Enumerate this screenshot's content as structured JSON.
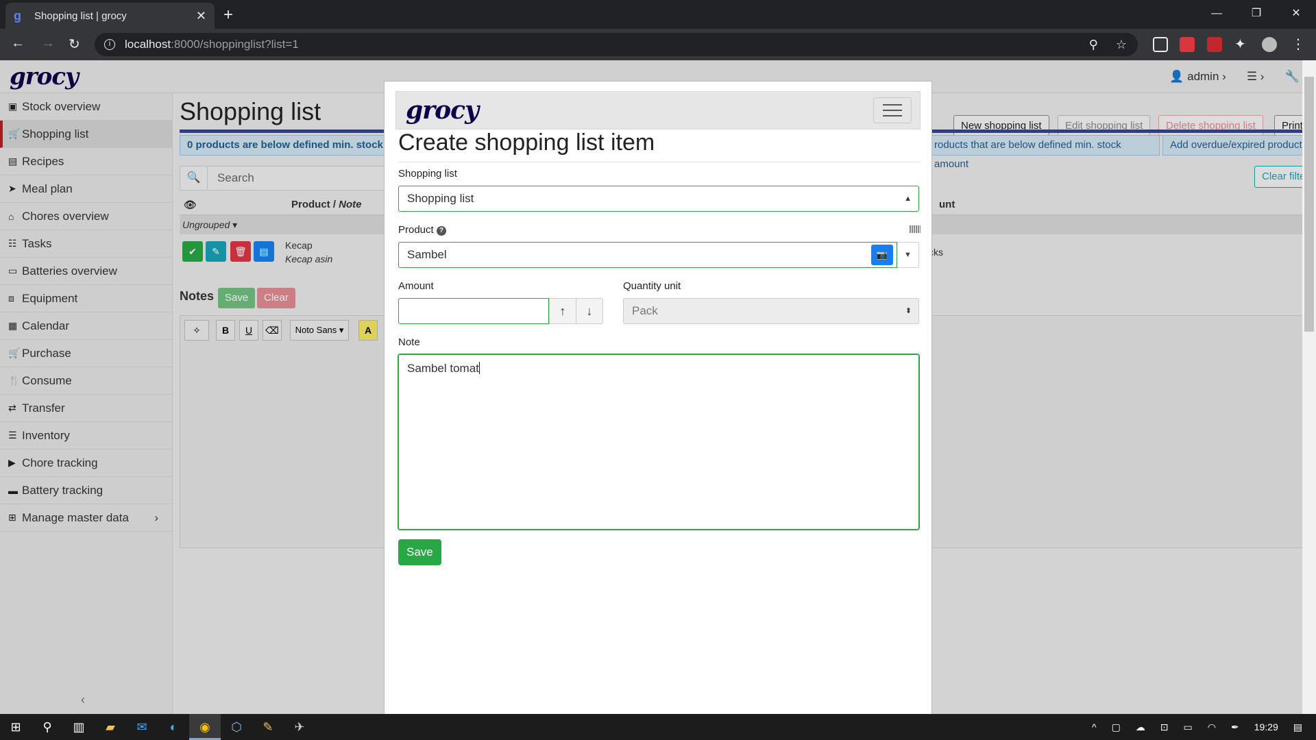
{
  "browser": {
    "tab_title": "Shopping list | grocy",
    "tab_favicon": "g",
    "url_host": "localhost",
    "url_path": ":8000/shoppinglist?list=1"
  },
  "app": {
    "logo": "grocy",
    "user": "admin"
  },
  "sidebar": {
    "items": [
      {
        "label": "Stock overview",
        "icon": "box-icon"
      },
      {
        "label": "Shopping list",
        "icon": "cart-icon"
      },
      {
        "label": "Recipes",
        "icon": "paste-icon"
      },
      {
        "label": "Meal plan",
        "icon": "paper-plane-icon"
      },
      {
        "label": "Chores overview",
        "icon": "home-icon"
      },
      {
        "label": "Tasks",
        "icon": "tasks-icon"
      },
      {
        "label": "Batteries overview",
        "icon": "battery-icon"
      },
      {
        "label": "Equipment",
        "icon": "toolbox-icon"
      },
      {
        "label": "Calendar",
        "icon": "calendar-icon"
      },
      {
        "label": "Purchase",
        "icon": "cart-plus-icon"
      },
      {
        "label": "Consume",
        "icon": "utensils-icon"
      },
      {
        "label": "Transfer",
        "icon": "exchange-icon"
      },
      {
        "label": "Inventory",
        "icon": "list-icon"
      },
      {
        "label": "Chore tracking",
        "icon": "play-icon"
      },
      {
        "label": "Battery tracking",
        "icon": "car-battery-icon"
      },
      {
        "label": "Manage master data",
        "icon": "table-icon"
      }
    ]
  },
  "background": {
    "title": "Shopping list",
    "alert_left": "0 products are below defined min. stock ar",
    "alert_right_1": "roducts that are below defined min. stock amount",
    "alert_right_2": "Add overdue/expired product",
    "btn_new": "New shopping list",
    "btn_edit": "Edit shopping list",
    "btn_delete": "Delete shopping list",
    "btn_print": "Print",
    "btn_clear_filter": "Clear filte",
    "search_placeholder": "Search",
    "col_product": "Product / ",
    "col_note": "Note",
    "col_amount": "unt",
    "group_label": "Ungrouped",
    "row_product": "Kecap",
    "row_note": "Kecap asin",
    "row_amount": "cks",
    "notes_heading": "Notes",
    "notes_save": "Save",
    "notes_clear": "Clear",
    "editor_font": "Noto Sans"
  },
  "modal": {
    "logo": "grocy",
    "title": "Create shopping list item",
    "shopping_list_label": "Shopping list",
    "shopping_list_value": "Shopping list",
    "product_label": "Product",
    "product_value": "Sambel",
    "amount_label": "Amount",
    "amount_value": "",
    "quantity_unit_label": "Quantity unit",
    "quantity_unit_value": "Pack",
    "note_label": "Note",
    "note_value": "Sambel tomat",
    "save_label": "Save"
  },
  "taskbar": {
    "time": "19:29"
  },
  "colors": {
    "accent_green": "#28a745",
    "accent_blue": "#1780ee",
    "brand_navy": "#0b024c",
    "active_red": "#ba1d20"
  }
}
